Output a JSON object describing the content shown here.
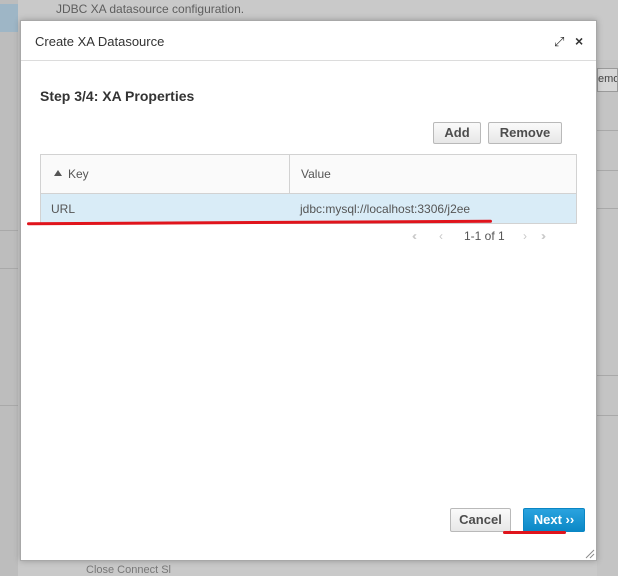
{
  "background": {
    "description_text": "JDBC XA datasource configuration.",
    "right_button_text": "emo",
    "bottom_text": "Close Connect Sl"
  },
  "dialog": {
    "title": "Create XA Datasource",
    "maximize_glyph": "⤢",
    "close_glyph": "×",
    "step_title": "Step 3/4: XA Properties",
    "toolbar": {
      "add_label": "Add",
      "remove_label": "Remove"
    },
    "table": {
      "columns": [
        {
          "label": "Key",
          "sorted": "ascending"
        },
        {
          "label": "Value"
        }
      ],
      "rows": [
        {
          "key": "URL",
          "value": "jdbc:mysql://localhost:3306/j2ee",
          "selected": true
        }
      ]
    },
    "pager": {
      "first_glyph": "‹‹",
      "prev_glyph": "‹",
      "info": "1-1 of 1",
      "next_glyph": "›",
      "last_glyph": "››"
    },
    "footer": {
      "cancel_label": "Cancel",
      "next_label": "Next ››"
    }
  },
  "colors": {
    "primary_button": "#0b88c6",
    "selected_row": "#d9ecf7",
    "annotation_underline": "#e0141c"
  }
}
